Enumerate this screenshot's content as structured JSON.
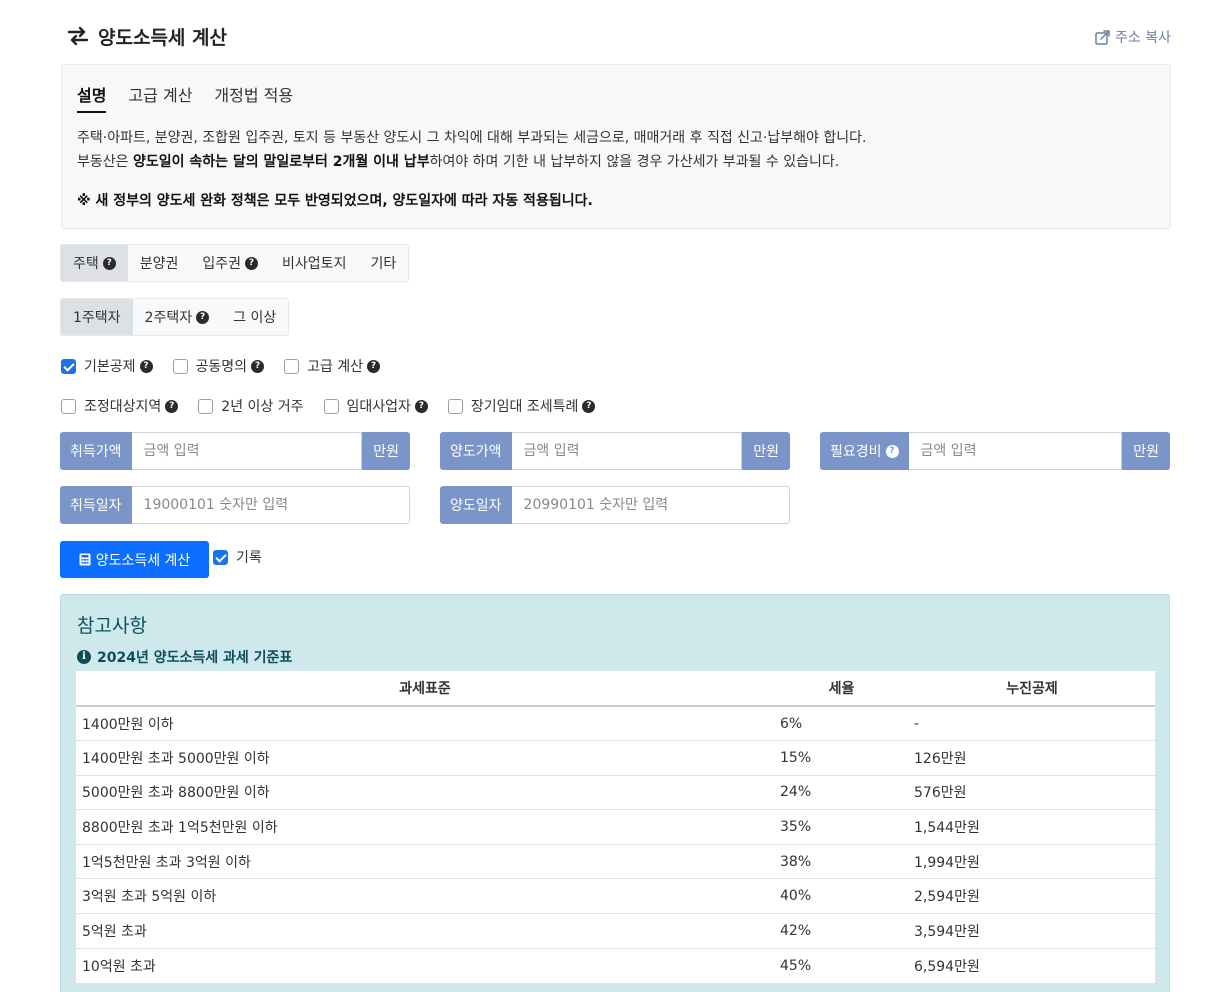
{
  "header": {
    "title": "양도소득세 계산",
    "copy_link": "주소 복사"
  },
  "description": {
    "tabs": [
      {
        "label": "설명",
        "active": true
      },
      {
        "label": "고급 계산",
        "active": false
      },
      {
        "label": "개정법 적용",
        "active": false
      }
    ],
    "line1": "주택·아파트, 분양권, 조합원 입주권, 토지 등 부동산 양도시 그 차익에 대해 부과되는 세금으로, 매매거래 후 직접 신고·납부해야 합니다.",
    "line2_prefix": "부동산은 ",
    "line2_bold": "양도일이 속하는 달의 말일로부터 2개월 이내 납부",
    "line2_suffix": "하여야 하며 기한 내 납부하지 않을 경우 가산세가 부과될 수 있습니다.",
    "note": "※ 새 정부의 양도세 완화 정책은 모두 반영되었으며, 양도일자에 따라 자동 적용됩니다."
  },
  "property_types": [
    {
      "label": "주택",
      "help": true,
      "active": true
    },
    {
      "label": "분양권",
      "help": false,
      "active": false
    },
    {
      "label": "입주권",
      "help": true,
      "active": false
    },
    {
      "label": "비사업토지",
      "help": false,
      "active": false
    },
    {
      "label": "기타",
      "help": false,
      "active": false
    }
  ],
  "owner_counts": [
    {
      "label": "1주택자",
      "help": false,
      "active": true
    },
    {
      "label": "2주택자",
      "help": true,
      "active": false
    },
    {
      "label": "그 이상",
      "help": false,
      "active": false
    }
  ],
  "options_row1": [
    {
      "label": "기본공제",
      "checked": true,
      "help": true
    },
    {
      "label": "공동명의",
      "checked": false,
      "help": true
    },
    {
      "label": "고급 계산",
      "checked": false,
      "help": true
    }
  ],
  "options_row2": [
    {
      "label": "조정대상지역",
      "checked": false,
      "help": true
    },
    {
      "label": "2년 이상 거주",
      "checked": false,
      "help": false
    },
    {
      "label": "임대사업자",
      "checked": false,
      "help": true
    },
    {
      "label": "장기임대 조세특례",
      "checked": false,
      "help": true
    }
  ],
  "inputs": {
    "acquisition_price": {
      "label": "취득가액",
      "placeholder": "금액 입력",
      "unit": "만원"
    },
    "transfer_price": {
      "label": "양도가액",
      "placeholder": "금액 입력",
      "unit": "만원"
    },
    "expenses": {
      "label": "필요경비",
      "placeholder": "금액 입력",
      "unit": "만원"
    },
    "acquisition_date": {
      "label": "취득일자",
      "placeholder": "19000101 숫자만 입력"
    },
    "transfer_date": {
      "label": "양도일자",
      "placeholder": "20990101 숫자만 입력"
    }
  },
  "calc_button": "양도소득세 계산",
  "record": {
    "label": "기록",
    "checked": true
  },
  "reference": {
    "title": "참고사항",
    "subtitle": "2024년 양도소득세 과세 기준표",
    "columns": [
      "과세표준",
      "세율",
      "누진공제"
    ],
    "rows": [
      [
        "1400만원 이하",
        "6%",
        "-"
      ],
      [
        "1400만원 초과 5000만원 이하",
        "15%",
        "126만원"
      ],
      [
        "5000만원 초과 8800만원 이하",
        "24%",
        "576만원"
      ],
      [
        "8800만원 초과 1억5천만원 이하",
        "35%",
        "1,544만원"
      ],
      [
        "1억5천만원 초과 3억원 이하",
        "38%",
        "1,994만원"
      ],
      [
        "3억원 초과 5억원 이하",
        "40%",
        "2,594만원"
      ],
      [
        "5억원 초과",
        "42%",
        "3,594만원"
      ],
      [
        "10억원 초과",
        "45%",
        "6,594만원"
      ]
    ]
  },
  "colors": {
    "primary": "#0d6efd",
    "input_label": "#7b95c9",
    "reference_bg": "#cfe8ec"
  }
}
